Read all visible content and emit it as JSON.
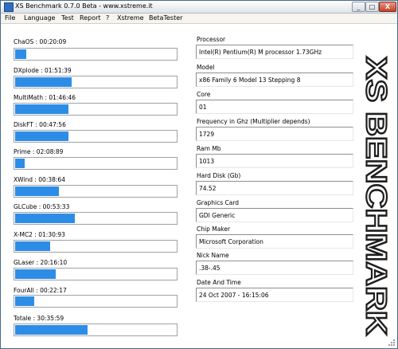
{
  "window": {
    "title": "XS Benchmark 0.7.0 Beta - www.xstreme.it",
    "minimize_glyph": "_",
    "maximize_glyph": "□",
    "close_glyph": "X"
  },
  "menu": [
    "File",
    "Language",
    "Test",
    "Report",
    "?",
    "Xstreme",
    "BetaTester"
  ],
  "benchmarks": [
    {
      "label": "ChaOS :    00:20:09",
      "progress": 0.07
    },
    {
      "label": "DXplode :  01:51:39",
      "progress": 0.35
    },
    {
      "label": "MultiMath : 01:46:46",
      "progress": 0.33
    },
    {
      "label": "DiskFT :    00:47:56",
      "progress": 0.33
    },
    {
      "label": "Prime :      02:08:89",
      "progress": 0.06
    },
    {
      "label": "XWind :      00:38:64",
      "progress": 0.27
    },
    {
      "label": "GLCube :    00:53:33",
      "progress": 0.37
    },
    {
      "label": "X-MC2 :      01:30:93",
      "progress": 0.22
    },
    {
      "label": "GLaser :      20:16:10",
      "progress": 0.25
    },
    {
      "label": "FourAll :     00:22:17",
      "progress": 0.12
    },
    {
      "label": "Totale :      30:35:59",
      "progress": 0.45
    }
  ],
  "info": [
    {
      "label": "Processor",
      "value": "Intel(R) Pentium(R) M processor 1.73GHz"
    },
    {
      "label": "Model",
      "value": "x86 Family 6 Model 13 Stepping 8"
    },
    {
      "label": "Core",
      "value": "01"
    },
    {
      "label": "Frequency in Ghz (Multiplier depends)",
      "value": "1729"
    },
    {
      "label": "Ram Mb",
      "value": "1013"
    },
    {
      "label": "Hard Disk (Gb)",
      "value": "74.52"
    },
    {
      "label": "Graphics Card",
      "value": "GDI Generic"
    },
    {
      "label": "Chip Maker",
      "value": "Microsoft Corporation"
    },
    {
      "label": "Nick Name",
      "value": ".38-.45"
    },
    {
      "label": "Date And Time",
      "value": "24 Oct 2007  -  16:15:06"
    }
  ],
  "logo": {
    "text": "XS BENCHMARK"
  },
  "colors": {
    "bar_fill": "#2d8de6",
    "panel_bg": "#ffffff",
    "window_bg": "#ece9d8"
  }
}
